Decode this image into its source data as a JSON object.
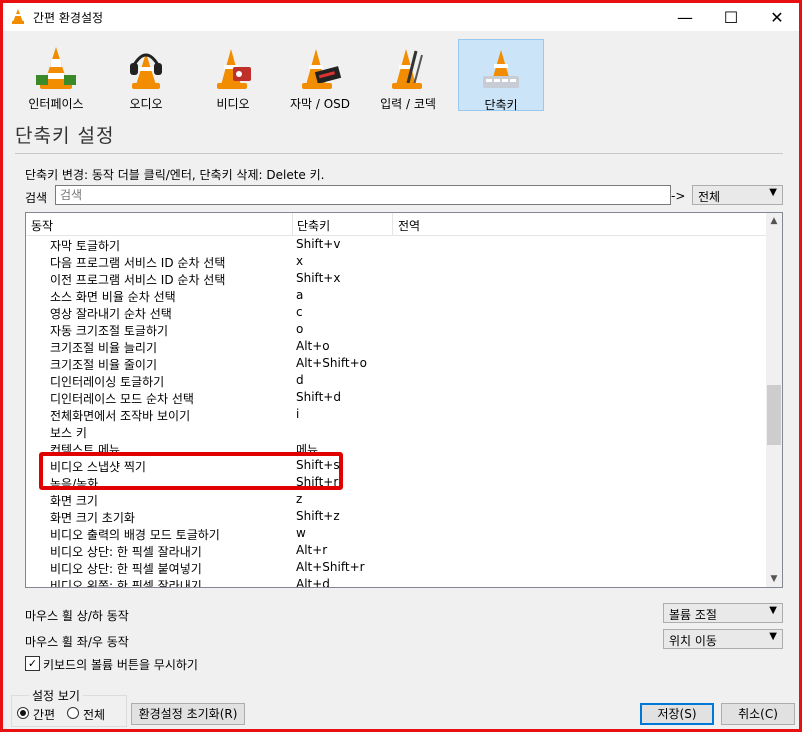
{
  "window": {
    "title": "간편 환경설정",
    "controls": {
      "minimize": "—",
      "maximize": "☐",
      "close": "✕"
    }
  },
  "toolbar": {
    "items": [
      {
        "label": "인터페이스",
        "icon": "interface-cone-icon"
      },
      {
        "label": "오디오",
        "icon": "audio-headphones-cone-icon"
      },
      {
        "label": "비디오",
        "icon": "video-cone-icon"
      },
      {
        "label": "자막 / OSD",
        "icon": "subtitles-cone-icon"
      },
      {
        "label": "입력 / 코덱",
        "icon": "input-codec-cone-icon"
      },
      {
        "label": "단축키",
        "icon": "hotkeys-cone-icon",
        "selected": true
      }
    ]
  },
  "section_title": "단축키 설정",
  "hint": "단축키 변경: 동작 더블 클릭/엔터, 단축키 삭제: Delete 키.",
  "search": {
    "label": "검색",
    "placeholder": "검색",
    "value": "",
    "arrow": "->",
    "scope": "전체"
  },
  "table": {
    "columns": [
      "동작",
      "단축키",
      "전역"
    ],
    "rows": [
      {
        "action": "자막 토글하기",
        "key": "Shift+v"
      },
      {
        "action": "다음 프로그램 서비스 ID 순차 선택",
        "key": "x"
      },
      {
        "action": "이전 프로그램 서비스 ID 순차 선택",
        "key": "Shift+x"
      },
      {
        "action": "소스 화면 비율 순차 선택",
        "key": "a"
      },
      {
        "action": "영상 잘라내기 순차 선택",
        "key": "c"
      },
      {
        "action": "자동 크기조절 토글하기",
        "key": "o"
      },
      {
        "action": "크기조절 비율 늘리기",
        "key": "Alt+o"
      },
      {
        "action": "크기조절 비율 줄이기",
        "key": "Alt+Shift+o"
      },
      {
        "action": "디인터레이싱 토글하기",
        "key": "d"
      },
      {
        "action": "디인터레이스 모드 순차 선택",
        "key": "Shift+d"
      },
      {
        "action": "전체화면에서 조작바 보이기",
        "key": "i"
      },
      {
        "action": "보스 키",
        "key": ""
      },
      {
        "action": "컨텍스트 메뉴",
        "key": "메뉴"
      },
      {
        "action": "비디오 스냅샷 찍기",
        "key": "Shift+s"
      },
      {
        "action": "녹음/녹화",
        "key": "Shift+r"
      },
      {
        "action": "화면 크기",
        "key": "z"
      },
      {
        "action": "화면 크기 초기화",
        "key": "Shift+z"
      },
      {
        "action": "비디오 출력의 배경 모드 토글하기",
        "key": "w"
      },
      {
        "action": "비디오 상단: 한 픽셀 잘라내기",
        "key": "Alt+r"
      },
      {
        "action": "비디오 상단: 한 픽셀 붙여넣기",
        "key": "Alt+Shift+r"
      },
      {
        "action": "비디오 왼쪽: 한 픽셀 잘라내기",
        "key": "Alt+d"
      }
    ]
  },
  "mouse": {
    "wheel_vertical_label": "마우스 휠 상/하 동작",
    "wheel_vertical_value": "볼륨 조절",
    "wheel_horizontal_label": "마우스 휠 좌/우 동작",
    "wheel_horizontal_value": "위치 이동"
  },
  "ignore_volume_keys": {
    "label": "키보드의 볼륨 버튼을 무시하기",
    "checked": true
  },
  "view": {
    "group_label": "설정 보기",
    "simple": "간편",
    "all": "전체",
    "selected": "simple"
  },
  "buttons": {
    "reset": "환경설정 초기화(R)",
    "save": "저장(S)",
    "cancel": "취소(C)"
  },
  "colors": {
    "accent_border": "#e81010",
    "selection": "#cce4f7",
    "cone_orange": "#f28c00"
  }
}
